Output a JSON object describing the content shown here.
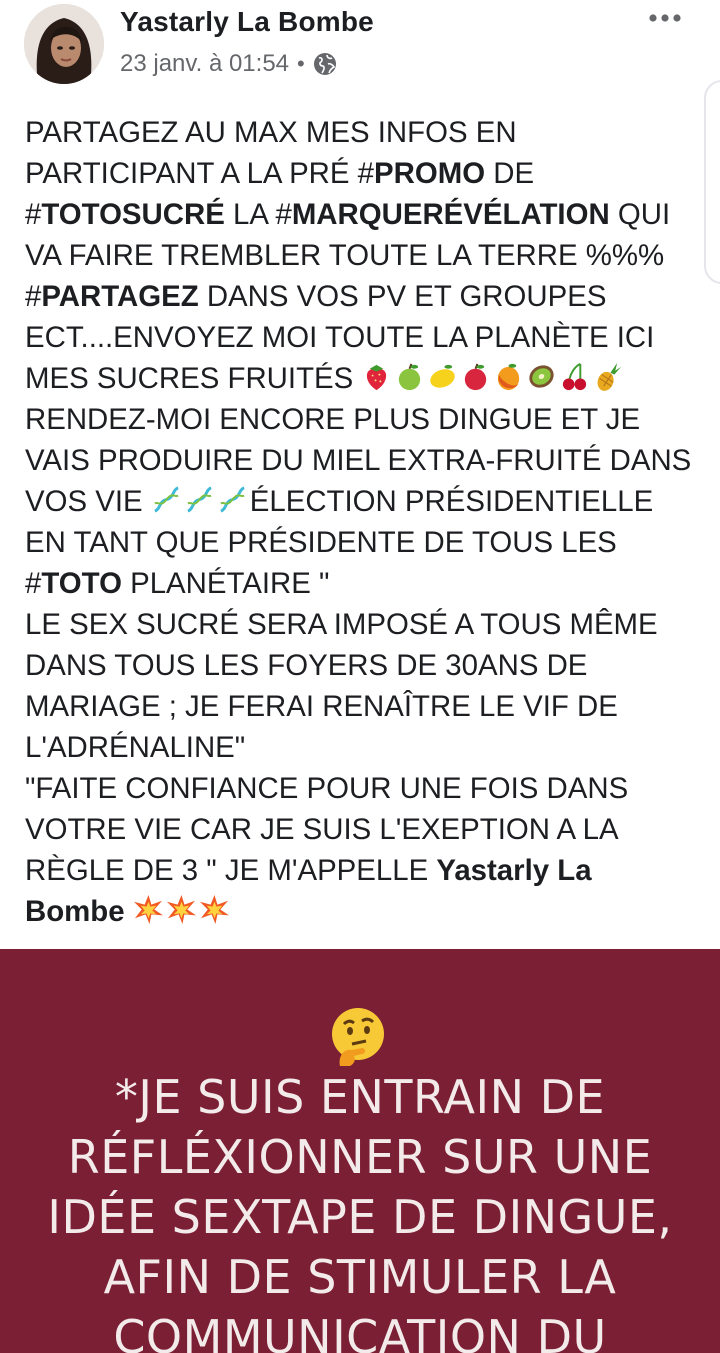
{
  "post": {
    "author": "Yastarly La Bombe",
    "date": "23 janv. à 01:54",
    "separator": "•",
    "privacy_icon": "globe-icon",
    "menu_icon": "more-options-icon",
    "text": {
      "l1": "PARTAGEZ AU MAX MES INFOS EN",
      "l2a": "PARTICIPANT A LA PRÉ #",
      "l2b": "PROMO",
      "l2c": " DE",
      "l3a": "#",
      "l3b": "TOTOSUCRÉ",
      "l3c": " LA #",
      "l3d": "MARQUERÉVÉLATION",
      "l3e": " QUI",
      "l4": "VA FAIRE TREMBLER TOUTE LA TERRE %%%",
      "l5a": "#",
      "l5b": "PARTAGEZ",
      "l5c": " DANS VOS PV ET GROUPES",
      "l6": "ECT....ENVOYEZ MOI TOUTE LA PLANÈTE ICI",
      "l7": "MES SUCRES FRUITÉS ",
      "l8": "RENDEZ-MOI ENCORE PLUS DINGUE ET JE",
      "l9": "VAIS PRODUIRE DU MIEL EXTRA-FRUITÉ DANS",
      "l10a": "VOS VIE ",
      "l10b": "ÉLECTION PRÉSIDENTIELLE",
      "l11": "EN TANT QUE PRÉSIDENTE DE TOUS LES",
      "l12a": "#",
      "l12b": "TOTO",
      "l12c": " PLANÉTAIRE \"",
      "l13": "LE SEX SUCRÉ SERA IMPOSÉ A TOUS MÊME",
      "l14": "DANS TOUS LES FOYERS DE 30ANS DE",
      "l15": "MARIAGE ; JE FERAI RENAÎTRE LE VIF DE",
      "l16": "L'ADRÉNALINE\"",
      "l17": "\"FAITE CONFIANCE POUR UNE FOIS DANS",
      "l18": "VOTRE VIE CAR JE SUIS L'EXEPTION A LA",
      "l19a": "RÈGLE DE 3 \" JE M'APPELLE ",
      "l19b": "Yastarly La",
      "l20": "Bombe "
    },
    "fruit_emojis": [
      "strawberry-icon",
      "green-apple-icon",
      "lemon-icon",
      "red-apple-icon",
      "mango-icon",
      "kiwi-icon",
      "cherries-icon",
      "pineapple-icon"
    ],
    "dna_emojis": [
      "dna-icon",
      "dna-icon",
      "dna-icon"
    ],
    "explosion_emojis": [
      "collision-icon",
      "collision-icon",
      "collision-icon"
    ]
  },
  "image_card": {
    "background": "#7b1f35",
    "emoji": "thinking-face-icon",
    "text": "*JE SUIS ENTRAIN DE\nRÉFLÉXIONNER SUR UNE\nIDÉE SEXTAPE DE DINGUE,\nAFIN DE STIMULER LA\nCOMMUNICATION DU"
  }
}
